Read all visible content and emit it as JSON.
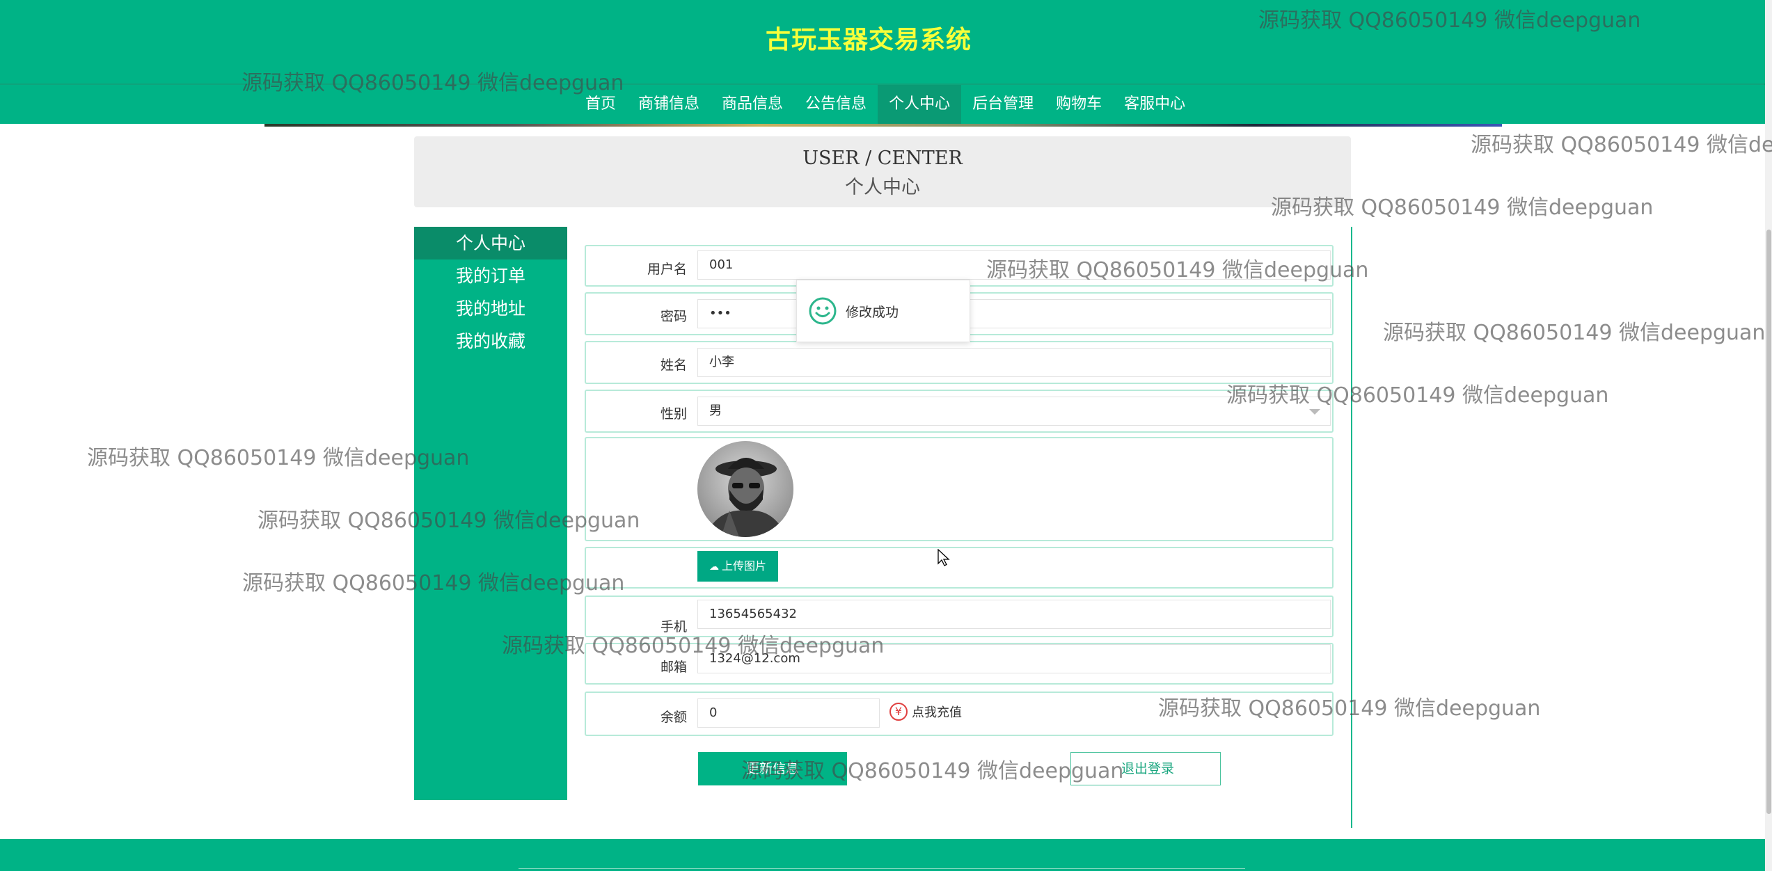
{
  "site": {
    "title": "古玩玉器交易系统"
  },
  "nav": {
    "items": [
      {
        "label": "首页"
      },
      {
        "label": "商铺信息"
      },
      {
        "label": "商品信息"
      },
      {
        "label": "公告信息"
      },
      {
        "label": "个人中心"
      },
      {
        "label": "后台管理"
      },
      {
        "label": "购物车"
      },
      {
        "label": "客服中心"
      }
    ],
    "active": "个人中心"
  },
  "page_header": {
    "en": "USER / CENTER",
    "cn": "个人中心"
  },
  "sidebar": {
    "items": [
      {
        "label": "个人中心"
      },
      {
        "label": "我的订单"
      },
      {
        "label": "我的地址"
      },
      {
        "label": "我的收藏"
      }
    ],
    "active": "个人中心"
  },
  "form": {
    "username": {
      "label": "用户名",
      "value": "001"
    },
    "password": {
      "label": "密码",
      "value": "•••"
    },
    "name": {
      "label": "姓名",
      "value": "小李"
    },
    "gender": {
      "label": "性别",
      "value": "男"
    },
    "upload_label": "上传图片",
    "phone": {
      "label": "手机",
      "value": "13654565432"
    },
    "email": {
      "label": "邮箱",
      "value": "1324@12.com"
    },
    "balance": {
      "label": "余额",
      "value": "0"
    },
    "recharge_label": "点我充值",
    "update_button": "更新信息",
    "logout_button": "退出登录"
  },
  "toast": {
    "message": "修改成功"
  },
  "watermark": {
    "text": "源码获取 QQ86050149 微信deepguan"
  },
  "colors": {
    "primary": "#00b386",
    "title": "#f7ff3a",
    "recharge": "#e04040"
  }
}
